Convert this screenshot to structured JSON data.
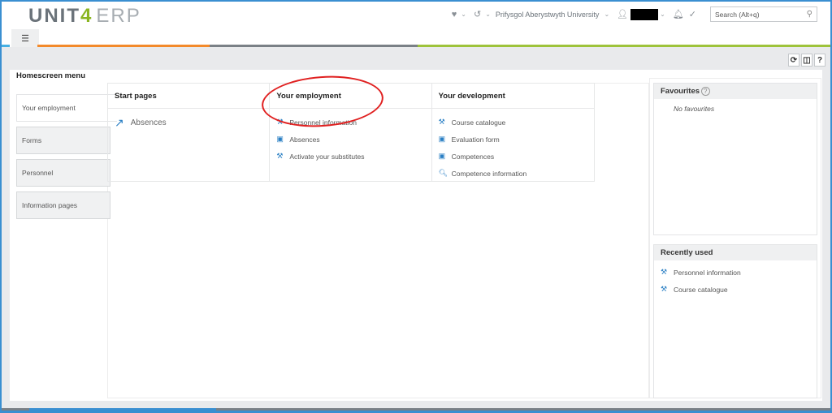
{
  "header": {
    "logo_main": "UNIT",
    "logo_four": "4",
    "logo_product": "ERP",
    "organisation": "Prifysgol Aberystwyth University",
    "search_placeholder": "Search (Alt+q)",
    "icons": [
      "heart-icon",
      "history-icon",
      "user-icon",
      "bell-icon",
      "check-icon",
      "search-icon"
    ]
  },
  "menu_tab_icon": "list-icon",
  "toolbar": {
    "refresh_glyph": "⟳",
    "layout_glyph": "◫",
    "help_glyph": "?"
  },
  "homescreen": {
    "title": "Homescreen menu",
    "side_items": [
      {
        "label": "Your employment",
        "active": true
      },
      {
        "label": "Forms",
        "active": false
      },
      {
        "label": "Personnel",
        "active": false
      },
      {
        "label": "Information pages",
        "active": false
      }
    ],
    "columns": [
      {
        "title": "Start pages",
        "items": [
          {
            "label": "Absences",
            "icon": "external-link-icon"
          }
        ]
      },
      {
        "title": "Your employment",
        "items": [
          {
            "label": "Personnel information",
            "icon": "tools-icon"
          },
          {
            "label": "Absences",
            "icon": "image-icon"
          },
          {
            "label": "Activate your substitutes",
            "icon": "tools-icon"
          }
        ]
      },
      {
        "title": "Your development",
        "items": [
          {
            "label": "Course catalogue",
            "icon": "tools-icon"
          },
          {
            "label": "Evaluation form",
            "icon": "image-icon"
          },
          {
            "label": "Competences",
            "icon": "image-icon"
          },
          {
            "label": "Competence information",
            "icon": "search-icon"
          }
        ]
      }
    ]
  },
  "favourites": {
    "title": "Favourites",
    "help": "?",
    "empty_text": "No favourites"
  },
  "recently_used": {
    "title": "Recently used",
    "items": [
      {
        "label": "Personnel information",
        "icon": "tools-icon"
      },
      {
        "label": "Course catalogue",
        "icon": "tools-icon"
      }
    ]
  }
}
